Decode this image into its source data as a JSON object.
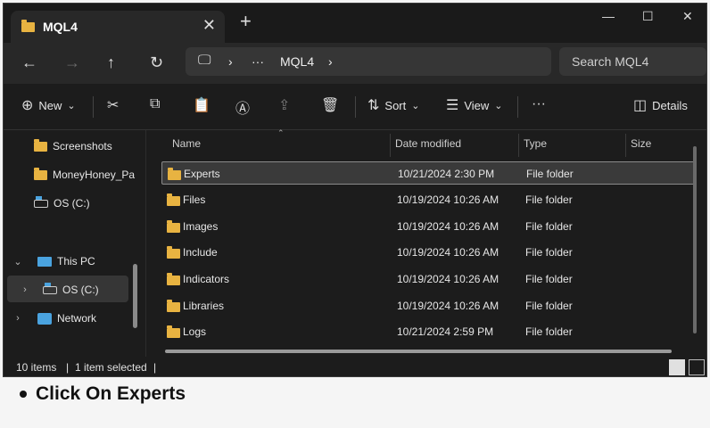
{
  "window": {
    "tab_title": "MQL4",
    "tab_close": "✕",
    "new_tab": "+",
    "minimize": "—",
    "maximize": "☐",
    "close": "✕"
  },
  "address": {
    "back": "←",
    "forward": "→",
    "up": "↑",
    "refresh": "↻",
    "pc_icon": "🖵",
    "sep1": "›",
    "ellipsis": "···",
    "current": "MQL4",
    "sep2": "›",
    "search_placeholder": "Search MQL4"
  },
  "toolbar": {
    "new_label": "New",
    "sort_label": "Sort",
    "view_label": "View",
    "more": "···",
    "details_label": "Details",
    "icons": {
      "new": "⊕",
      "cut": "✂",
      "copy": "⧉",
      "paste": "📋",
      "rename": "Ⓐ",
      "share": "⇪",
      "delete": "🗑",
      "sort": "⇅",
      "view": "☰",
      "details": "◫",
      "caret": "⌄"
    }
  },
  "nav": {
    "items": [
      {
        "label": "Screenshots"
      },
      {
        "label": "MoneyHoney_Pa"
      },
      {
        "label": "OS (C:)"
      },
      {
        "label": "This PC"
      },
      {
        "label": "OS (C:)"
      },
      {
        "label": "Network"
      }
    ],
    "chev_down": "⌄",
    "chev_right": "›"
  },
  "list": {
    "columns": {
      "name": "Name",
      "date": "Date modified",
      "type": "Type",
      "size": "Size"
    },
    "sort_arrow": "⌃",
    "rows": [
      {
        "name": "Experts",
        "date": "10/21/2024 2:30 PM",
        "type": "File folder"
      },
      {
        "name": "Files",
        "date": "10/19/2024 10:26 AM",
        "type": "File folder"
      },
      {
        "name": "Images",
        "date": "10/19/2024 10:26 AM",
        "type": "File folder"
      },
      {
        "name": "Include",
        "date": "10/19/2024 10:26 AM",
        "type": "File folder"
      },
      {
        "name": "Indicators",
        "date": "10/19/2024 10:26 AM",
        "type": "File folder"
      },
      {
        "name": "Libraries",
        "date": "10/19/2024 10:26 AM",
        "type": "File folder"
      },
      {
        "name": "Logs",
        "date": "10/21/2024 2:59 PM",
        "type": "File folder"
      }
    ]
  },
  "status": {
    "items": "10 items",
    "sep": "|",
    "selected": "1 item selected",
    "sep2": "|"
  },
  "caption": {
    "text": "Click On Experts"
  },
  "colors": {
    "window_bg": "#1c1c1c",
    "folder": "#e8b341",
    "accent": "#4aa3df",
    "selection": "#3a3a3a"
  }
}
